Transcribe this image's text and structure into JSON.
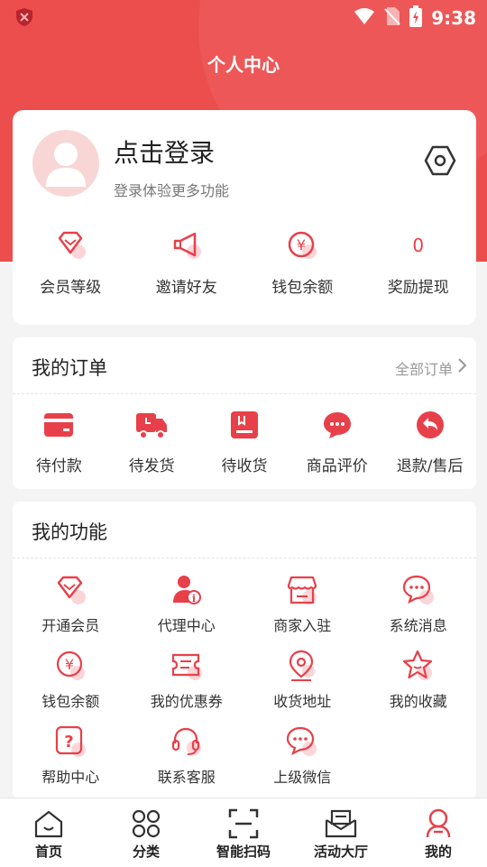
{
  "status_bar": {
    "time": "9:38"
  },
  "header": {
    "title": "个人中心"
  },
  "profile": {
    "login_title": "点击登录",
    "login_subtitle": "登录体验更多功能",
    "stats": [
      {
        "icon": "diamond-icon",
        "label": "会员等级"
      },
      {
        "icon": "megaphone-icon",
        "label": "邀请好友"
      },
      {
        "icon": "yen-coin-icon",
        "label": "钱包余额"
      },
      {
        "value": "0",
        "label": "奖励提现"
      }
    ]
  },
  "orders": {
    "title": "我的订单",
    "all_link": "全部订单",
    "items": [
      {
        "icon": "card-icon",
        "label": "待付款"
      },
      {
        "icon": "truck-icon",
        "label": "待发货"
      },
      {
        "icon": "package-icon",
        "label": "待收货"
      },
      {
        "icon": "chat-bubble-icon",
        "label": "商品评价"
      },
      {
        "icon": "return-icon",
        "label": "退款/售后"
      }
    ]
  },
  "functions": {
    "title": "我的功能",
    "items": [
      {
        "icon": "diamond-icon",
        "label": "开通会员"
      },
      {
        "icon": "agent-icon",
        "label": "代理中心"
      },
      {
        "icon": "store-icon",
        "label": "商家入驻"
      },
      {
        "icon": "message-icon",
        "label": "系统消息"
      },
      {
        "icon": "yen-coin-icon",
        "label": "钱包余额"
      },
      {
        "icon": "coupon-icon",
        "label": "我的优惠券"
      },
      {
        "icon": "location-pin-icon",
        "label": "收货地址"
      },
      {
        "icon": "star-icon",
        "label": "我的收藏"
      },
      {
        "icon": "question-icon",
        "label": "帮助中心"
      },
      {
        "icon": "headset-icon",
        "label": "联系客服"
      },
      {
        "icon": "wechat-icon",
        "label": "上级微信"
      }
    ]
  },
  "tabbar": {
    "items": [
      {
        "icon": "home-icon",
        "label": "首页"
      },
      {
        "icon": "grid-icon",
        "label": "分类"
      },
      {
        "icon": "scan-icon",
        "label": "智能扫码"
      },
      {
        "icon": "mail-icon",
        "label": "活动大厅"
      },
      {
        "icon": "user-icon",
        "label": "我的"
      }
    ]
  },
  "colors": {
    "accent": "#ec4d4d",
    "icon_red": "#e8404a",
    "icon_pink": "#fbd5d8"
  }
}
